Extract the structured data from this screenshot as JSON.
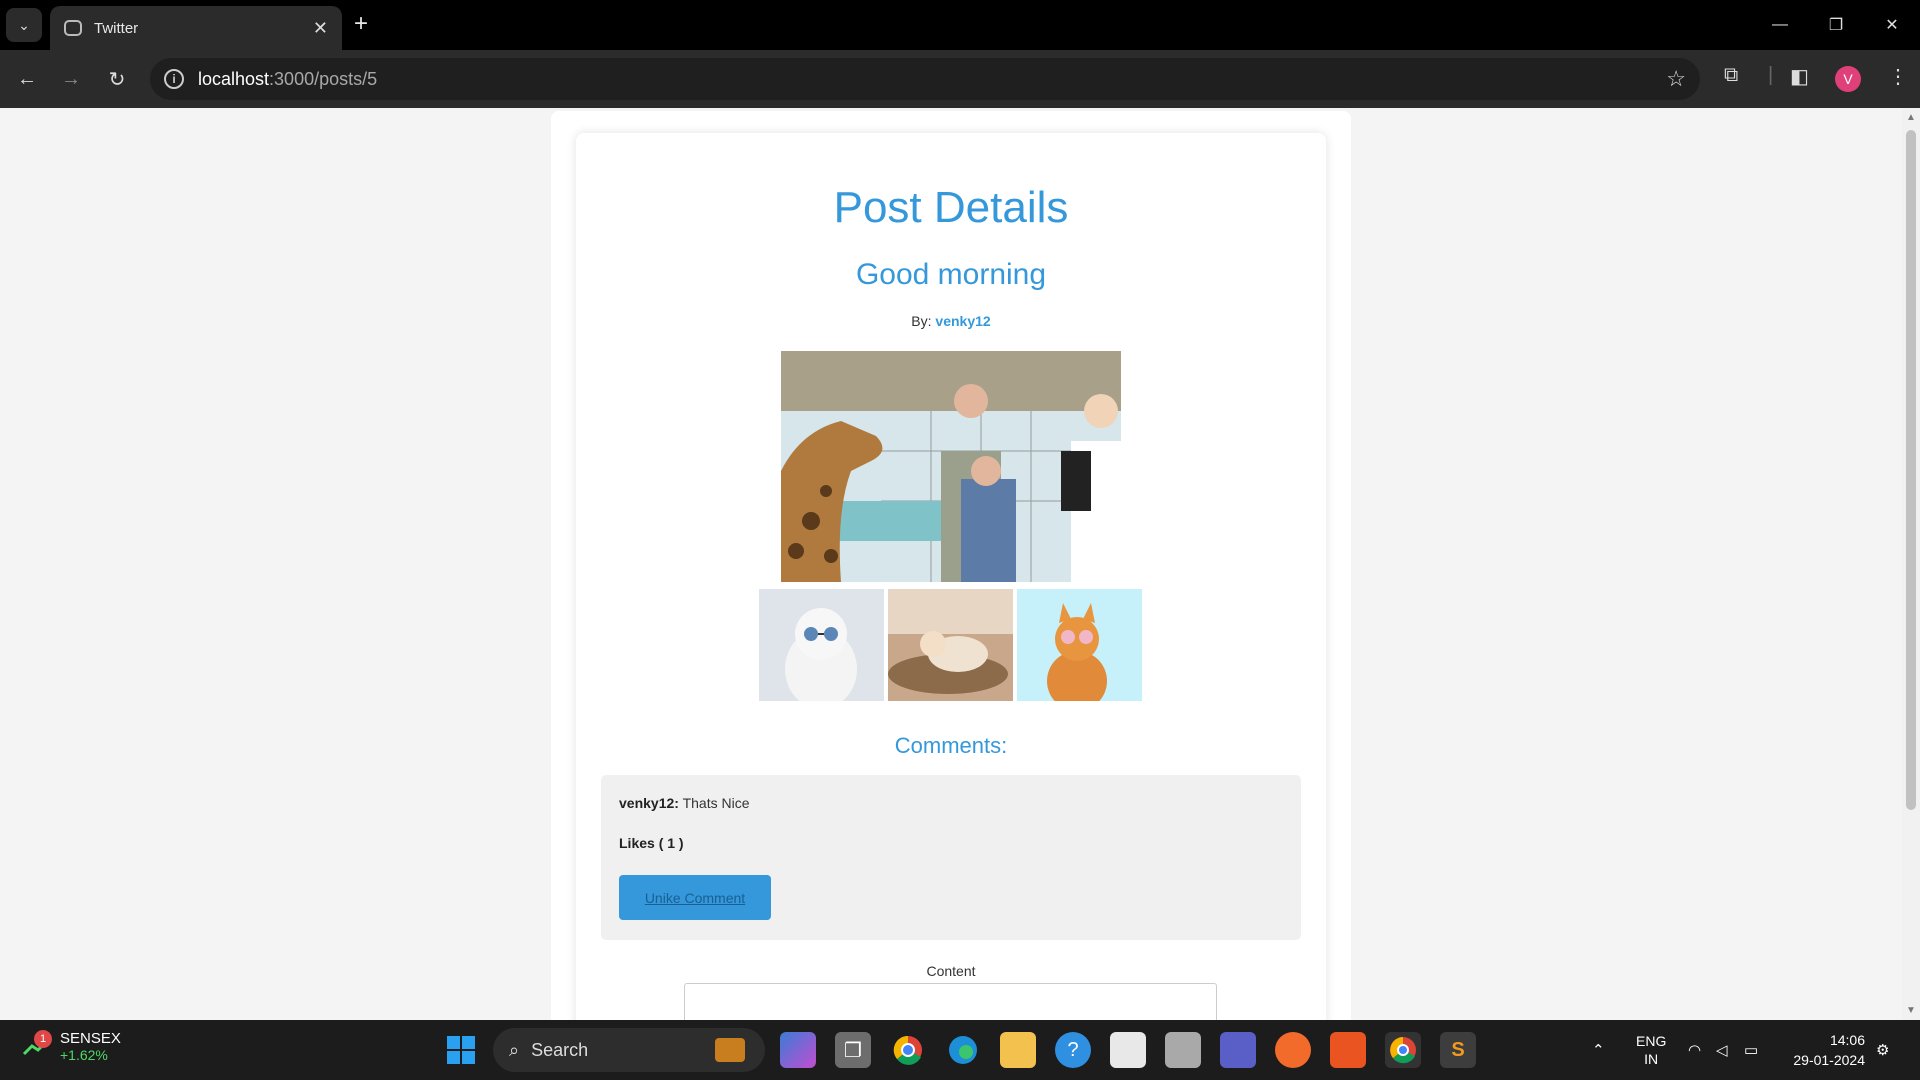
{
  "browser": {
    "tab_title": "Twitter",
    "url_host": "localhost",
    "url_path": ":3000/posts/5",
    "profile_initial": "V"
  },
  "page": {
    "heading": "Post Details",
    "post_title": "Good morning",
    "byline_prefix": "By: ",
    "author": "venky12",
    "comments_heading": "Comments:",
    "comments": [
      {
        "author": "venky12:",
        "text": " Thats Nice",
        "likes_label": "Likes ( 1 )",
        "unlike_label": "Unike Comment"
      }
    ],
    "content_label": "Content",
    "accent_color": "#3498db"
  },
  "taskbar": {
    "ticker_badge": "1",
    "ticker_name": "SENSEX",
    "ticker_change": "+1.62%",
    "search_placeholder": "Search",
    "language": "ENG",
    "region": "IN",
    "time": "14:06",
    "date": "29-01-2024"
  }
}
